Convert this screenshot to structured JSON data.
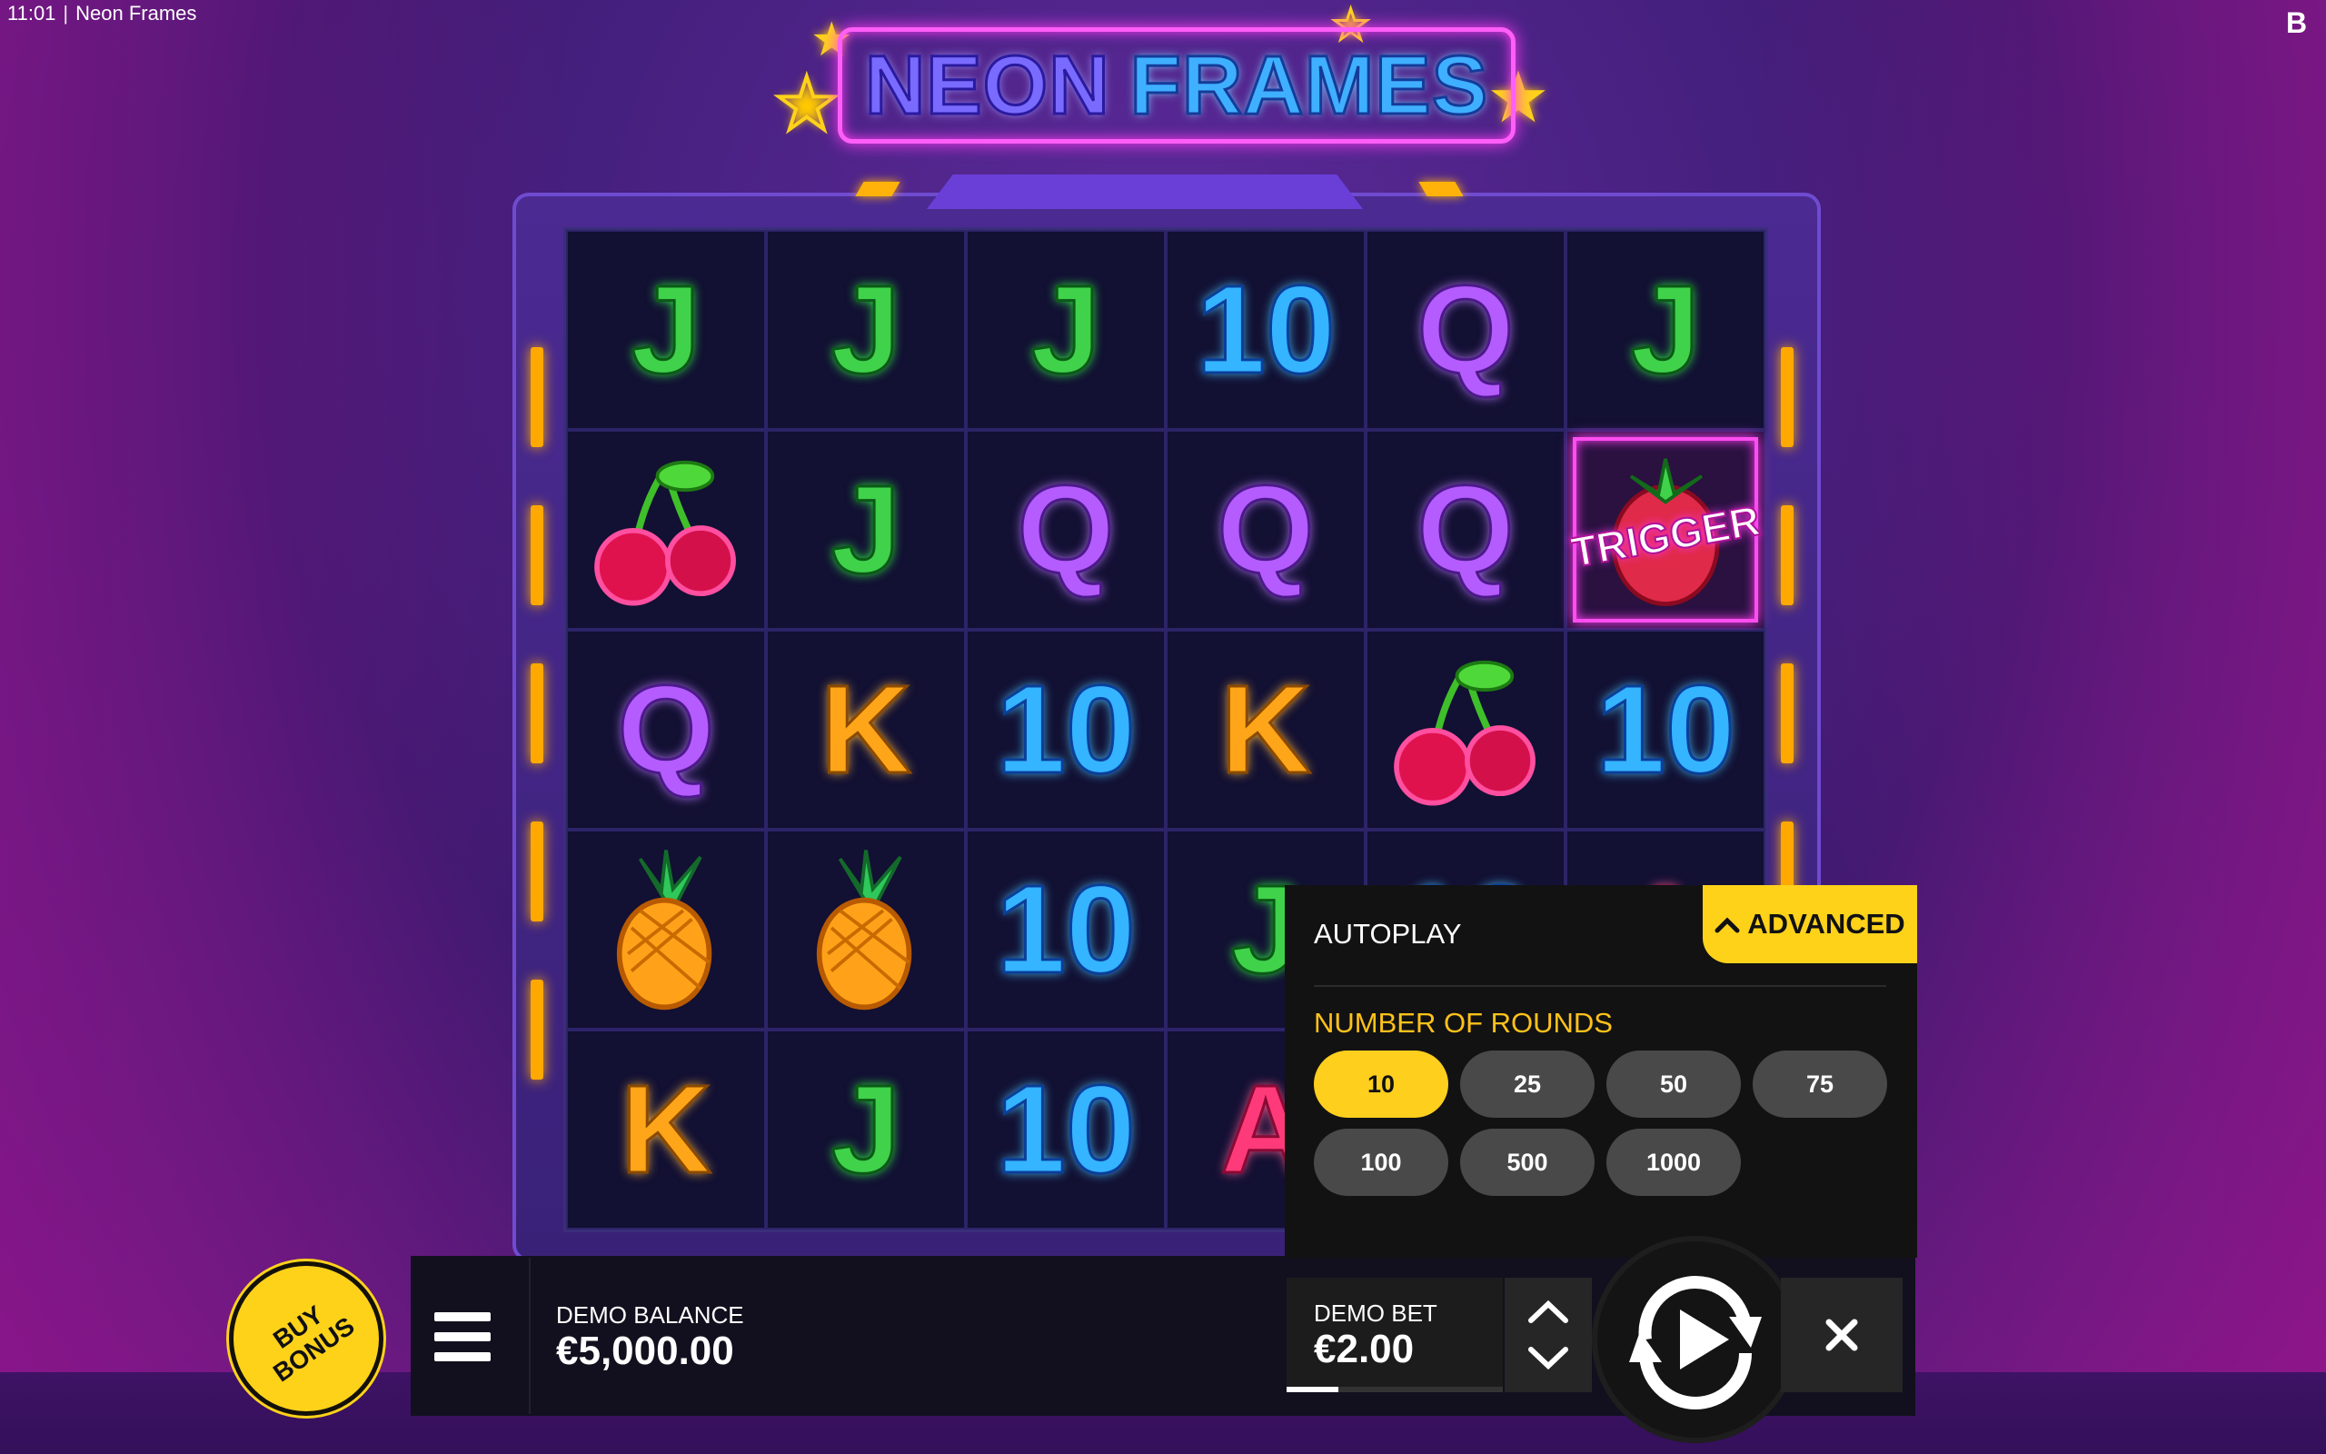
{
  "status": {
    "time": "11:01",
    "separator": "|",
    "app_title": "Neon Frames"
  },
  "brand": {
    "letter": "B"
  },
  "logo": {
    "word1": "NEON",
    "word2": "FRAMES"
  },
  "grid": {
    "rows": [
      [
        "J",
        "J",
        "J",
        "10",
        "Q",
        "J"
      ],
      [
        "cherry",
        "J",
        "Q",
        "Q",
        "Q",
        "strawberry-trigger"
      ],
      [
        "Q",
        "K",
        "10",
        "K",
        "cherry",
        "10"
      ],
      [
        "pineapple",
        "pineapple",
        "10",
        "J",
        "10",
        "A"
      ],
      [
        "K",
        "J",
        "10",
        "A",
        "",
        ""
      ]
    ],
    "trigger_label": "TRIGGER"
  },
  "buy_bonus": {
    "label": "BUY BONUS"
  },
  "balance": {
    "label": "DEMO BALANCE",
    "value": "€5,000.00"
  },
  "autoplay": {
    "title": "AUTOPLAY",
    "advanced_label": "ADVANCED",
    "rounds_label": "NUMBER OF ROUNDS",
    "round_options": [
      "10",
      "25",
      "50",
      "75",
      "100",
      "500",
      "1000"
    ],
    "selected_round": "10"
  },
  "bet": {
    "label": "DEMO BET",
    "value": "€2.00",
    "level_fraction": 0.24
  },
  "colors": {
    "accent": "#ffd21a",
    "neon_pink": "#ff4ef0",
    "panel": "#121212"
  }
}
